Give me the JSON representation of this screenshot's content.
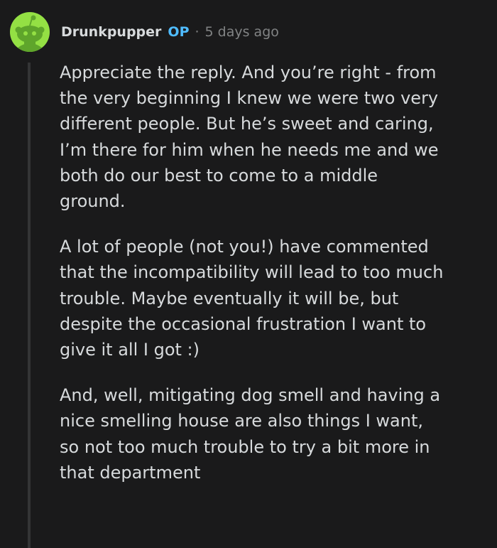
{
  "comment": {
    "author": "Drunkpupper",
    "badge": "OP",
    "separator": "·",
    "timestamp": "5 days ago",
    "avatar_icon": "snoo-avatar-icon",
    "colors": {
      "background": "#1a1a1b",
      "text": "#d7dadc",
      "meta": "#818384",
      "op_badge": "#4fbcff",
      "avatar_bg": "#94e044",
      "thread_line": "#343536"
    },
    "paragraphs": [
      "Appreciate the reply. And you’re right - from\nthe very beginning I knew we were two very\ndifferent people. But he’s sweet and caring,\nI’m there for him when he needs me and we\nboth do our best to come to a middle\nground.",
      "A lot of people (not you!) have commented\nthat the incompatibility will lead to too much\ntrouble. Maybe eventually it will be, but\ndespite the occasional frustration I want to\ngive it all I got :)",
      "And, well, mitigating dog smell and having a\nnice smelling house are also things I want,\nso not too much trouble to try a bit more in\nthat department"
    ]
  }
}
